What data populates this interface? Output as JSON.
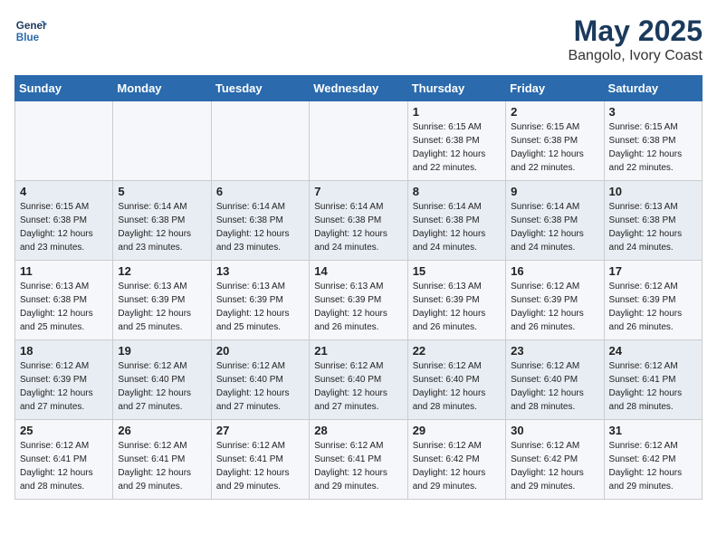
{
  "logo": {
    "line1": "General",
    "line2": "Blue"
  },
  "title": "May 2025",
  "subtitle": "Bangolo, Ivory Coast",
  "headers": [
    "Sunday",
    "Monday",
    "Tuesday",
    "Wednesday",
    "Thursday",
    "Friday",
    "Saturday"
  ],
  "weeks": [
    [
      {
        "day": "",
        "info": ""
      },
      {
        "day": "",
        "info": ""
      },
      {
        "day": "",
        "info": ""
      },
      {
        "day": "",
        "info": ""
      },
      {
        "day": "1",
        "info": "Sunrise: 6:15 AM\nSunset: 6:38 PM\nDaylight: 12 hours\nand 22 minutes."
      },
      {
        "day": "2",
        "info": "Sunrise: 6:15 AM\nSunset: 6:38 PM\nDaylight: 12 hours\nand 22 minutes."
      },
      {
        "day": "3",
        "info": "Sunrise: 6:15 AM\nSunset: 6:38 PM\nDaylight: 12 hours\nand 22 minutes."
      }
    ],
    [
      {
        "day": "4",
        "info": "Sunrise: 6:15 AM\nSunset: 6:38 PM\nDaylight: 12 hours\nand 23 minutes."
      },
      {
        "day": "5",
        "info": "Sunrise: 6:14 AM\nSunset: 6:38 PM\nDaylight: 12 hours\nand 23 minutes."
      },
      {
        "day": "6",
        "info": "Sunrise: 6:14 AM\nSunset: 6:38 PM\nDaylight: 12 hours\nand 23 minutes."
      },
      {
        "day": "7",
        "info": "Sunrise: 6:14 AM\nSunset: 6:38 PM\nDaylight: 12 hours\nand 24 minutes."
      },
      {
        "day": "8",
        "info": "Sunrise: 6:14 AM\nSunset: 6:38 PM\nDaylight: 12 hours\nand 24 minutes."
      },
      {
        "day": "9",
        "info": "Sunrise: 6:14 AM\nSunset: 6:38 PM\nDaylight: 12 hours\nand 24 minutes."
      },
      {
        "day": "10",
        "info": "Sunrise: 6:13 AM\nSunset: 6:38 PM\nDaylight: 12 hours\nand 24 minutes."
      }
    ],
    [
      {
        "day": "11",
        "info": "Sunrise: 6:13 AM\nSunset: 6:38 PM\nDaylight: 12 hours\nand 25 minutes."
      },
      {
        "day": "12",
        "info": "Sunrise: 6:13 AM\nSunset: 6:39 PM\nDaylight: 12 hours\nand 25 minutes."
      },
      {
        "day": "13",
        "info": "Sunrise: 6:13 AM\nSunset: 6:39 PM\nDaylight: 12 hours\nand 25 minutes."
      },
      {
        "day": "14",
        "info": "Sunrise: 6:13 AM\nSunset: 6:39 PM\nDaylight: 12 hours\nand 26 minutes."
      },
      {
        "day": "15",
        "info": "Sunrise: 6:13 AM\nSunset: 6:39 PM\nDaylight: 12 hours\nand 26 minutes."
      },
      {
        "day": "16",
        "info": "Sunrise: 6:12 AM\nSunset: 6:39 PM\nDaylight: 12 hours\nand 26 minutes."
      },
      {
        "day": "17",
        "info": "Sunrise: 6:12 AM\nSunset: 6:39 PM\nDaylight: 12 hours\nand 26 minutes."
      }
    ],
    [
      {
        "day": "18",
        "info": "Sunrise: 6:12 AM\nSunset: 6:39 PM\nDaylight: 12 hours\nand 27 minutes."
      },
      {
        "day": "19",
        "info": "Sunrise: 6:12 AM\nSunset: 6:40 PM\nDaylight: 12 hours\nand 27 minutes."
      },
      {
        "day": "20",
        "info": "Sunrise: 6:12 AM\nSunset: 6:40 PM\nDaylight: 12 hours\nand 27 minutes."
      },
      {
        "day": "21",
        "info": "Sunrise: 6:12 AM\nSunset: 6:40 PM\nDaylight: 12 hours\nand 27 minutes."
      },
      {
        "day": "22",
        "info": "Sunrise: 6:12 AM\nSunset: 6:40 PM\nDaylight: 12 hours\nand 28 minutes."
      },
      {
        "day": "23",
        "info": "Sunrise: 6:12 AM\nSunset: 6:40 PM\nDaylight: 12 hours\nand 28 minutes."
      },
      {
        "day": "24",
        "info": "Sunrise: 6:12 AM\nSunset: 6:41 PM\nDaylight: 12 hours\nand 28 minutes."
      }
    ],
    [
      {
        "day": "25",
        "info": "Sunrise: 6:12 AM\nSunset: 6:41 PM\nDaylight: 12 hours\nand 28 minutes."
      },
      {
        "day": "26",
        "info": "Sunrise: 6:12 AM\nSunset: 6:41 PM\nDaylight: 12 hours\nand 29 minutes."
      },
      {
        "day": "27",
        "info": "Sunrise: 6:12 AM\nSunset: 6:41 PM\nDaylight: 12 hours\nand 29 minutes."
      },
      {
        "day": "28",
        "info": "Sunrise: 6:12 AM\nSunset: 6:41 PM\nDaylight: 12 hours\nand 29 minutes."
      },
      {
        "day": "29",
        "info": "Sunrise: 6:12 AM\nSunset: 6:42 PM\nDaylight: 12 hours\nand 29 minutes."
      },
      {
        "day": "30",
        "info": "Sunrise: 6:12 AM\nSunset: 6:42 PM\nDaylight: 12 hours\nand 29 minutes."
      },
      {
        "day": "31",
        "info": "Sunrise: 6:12 AM\nSunset: 6:42 PM\nDaylight: 12 hours\nand 29 minutes."
      }
    ]
  ]
}
